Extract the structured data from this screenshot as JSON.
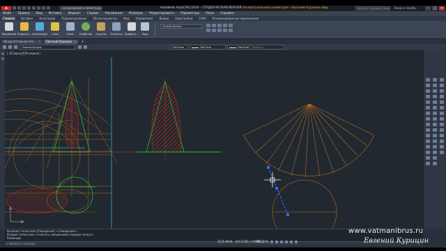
{
  "titlebar": {
    "logo": "A",
    "workspace": "2D-рисование и аннотации",
    "title_prefix": "Autodesk AutoCAD 2016 - СТУДЕНЧЕСКАЯ ВЕРСИЯ",
    "title_doc": "Начертательная геометрия - Евгений Курицин.dwg",
    "search_placeholder": "Введите ключевое слово/фразу",
    "user": "Вход в службы",
    "minimize": "–",
    "maximize": "□",
    "close": "×"
  },
  "menubar": [
    "Файл",
    "Правка",
    "Вид",
    "Вставка",
    "Формат",
    "Сервис",
    "Рисование",
    "Размеры",
    "Редактировать",
    "Параметры",
    "Окно",
    "Справка"
  ],
  "ribbon_tabs": [
    {
      "label": "Главная",
      "active": true
    },
    {
      "label": "Вставка",
      "active": false
    },
    {
      "label": "Аннотации",
      "active": false
    },
    {
      "label": "Параметризация",
      "active": false
    },
    {
      "label": "3D-инструменты",
      "active": false
    },
    {
      "label": "Вид",
      "active": false
    },
    {
      "label": "Управление",
      "active": false
    },
    {
      "label": "Вывод",
      "active": false
    },
    {
      "label": "Надстройки",
      "active": false
    },
    {
      "label": "A360",
      "active": false
    },
    {
      "label": "Рекомендованные приложения",
      "active": false
    }
  ],
  "ribbon_tools": [
    {
      "label": "Рисование",
      "color": "#d9d9d9"
    },
    {
      "label": "Редакти...",
      "color": "#e8b84a"
    },
    {
      "label": "Аннотации",
      "color": "#5aa8e0"
    },
    {
      "label": "Слои",
      "color": "#e0c04a"
    },
    {
      "label": "Блок",
      "color": "#9fb4cc"
    },
    {
      "label": "Свойства",
      "color": "#6fb05a"
    },
    {
      "label": "Группы",
      "color": "#c7a25a"
    },
    {
      "label": "Утилиты",
      "color": "#8fa3ba"
    },
    {
      "label": "Буфер о...",
      "color": "#d7d7d7"
    },
    {
      "label": "Вид",
      "color": "#b8c4d2"
    }
  ],
  "ribbon_layer_select": "Тонкая-Штрих",
  "doc_tabs": [
    {
      "label": "Начертательная гео...",
      "active": false
    },
    {
      "label": "Евгений Курицин",
      "active": true
    }
  ],
  "propbar": {
    "layer": "Тонкая-Штрих",
    "color": "ПоСлою",
    "linetype": "ПоСлою",
    "lineweight": "ПоСлою",
    "plotstyle": "ПоЦвету"
  },
  "viewport_label": "[–][Сверху][2D-каркас]",
  "command_lines": [
    "Базовая точка или [Смещение] <Смещение>:",
    "Вторая точка или <считать смещением первую точку>:",
    "Команда:"
  ],
  "command_placeholder": "Введите команду",
  "status": {
    "coords": "2535.6834, -343.5783, 0.0000",
    "model": "МОДЕЛЬ"
  },
  "watermark": {
    "site": "www.vatmanibrus.ru",
    "author": "Евгений Курицин"
  },
  "colors": {
    "canvas": "#212830",
    "construction": "#c2741c",
    "hatch": "#c2281e",
    "contour_green": "#2ebd35",
    "axis_cyan": "#1fb8cf",
    "grip_blue": "#2f6bff"
  }
}
